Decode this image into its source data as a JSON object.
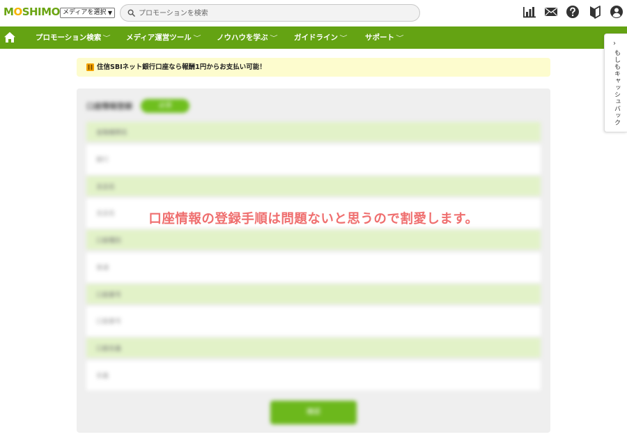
{
  "header": {
    "logo": {
      "pre": "M",
      "o": "O",
      "post": "SHIMO"
    },
    "media_select": "メディアを選択",
    "search_placeholder": "プロモーションを検索",
    "icons": [
      "chart-icon",
      "mail-icon",
      "help-icon",
      "beginner-icon",
      "user-icon"
    ]
  },
  "nav": {
    "items": [
      {
        "label": "プロモーション検索"
      },
      {
        "label": "メディア運営ツール"
      },
      {
        "label": "ノウハウを学ぶ"
      },
      {
        "label": "ガイドライン"
      },
      {
        "label": "サポート"
      }
    ],
    "chevron": "﹀"
  },
  "side_tab": {
    "label": "もしもキャッシュバック",
    "arrow": "›"
  },
  "notice": {
    "text": "住信SBIネット銀行口座なら報酬1円からお支払い可能！"
  },
  "form": {
    "title": "口座情報登録",
    "badge": "必須",
    "fields": [
      {
        "label": "金融機関名",
        "value": "銀行"
      },
      {
        "label": "支店名",
        "value": "支店名"
      },
      {
        "label": "口座種別",
        "value": "普通"
      },
      {
        "label": "口座番号",
        "value": "口座番号"
      },
      {
        "label": "口座名義",
        "value": "名義"
      }
    ],
    "submit_label": "確認"
  },
  "overlay_text": "口座情報の登録手順は問題ないと思うので割愛します。",
  "colors": {
    "brand_green": "#64a313",
    "notice_bg": "#fdfcce",
    "overlay_red": "#ef6f6f"
  }
}
